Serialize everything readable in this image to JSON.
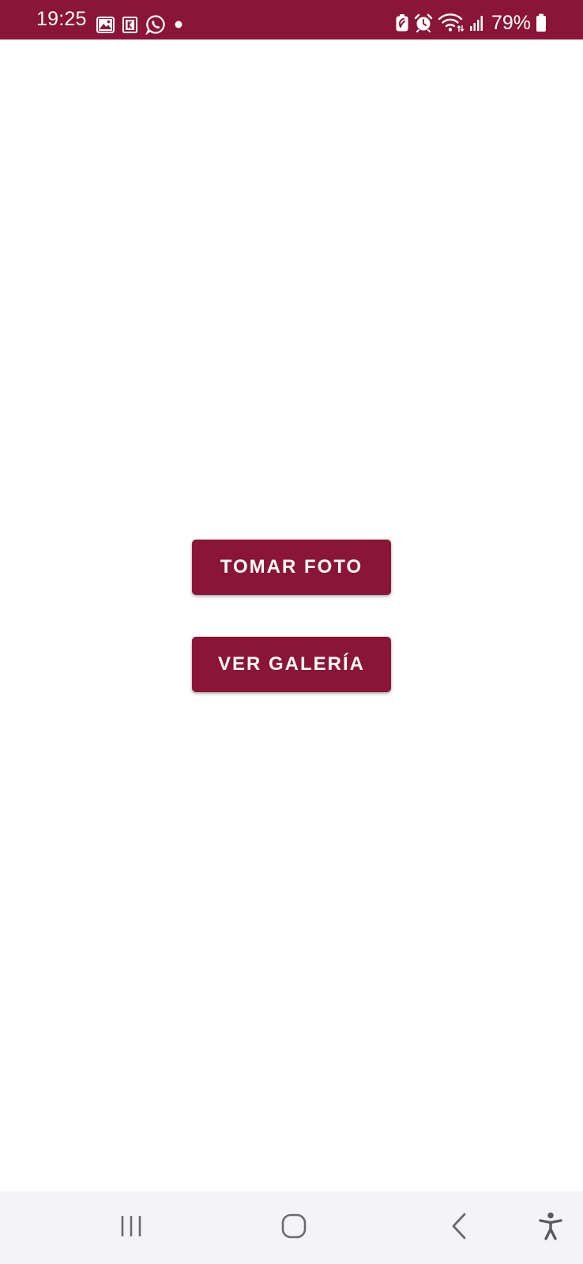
{
  "status_bar": {
    "time": "19:25",
    "battery_percent": "79%",
    "background_color": "#8a1538",
    "left_icons": [
      "gallery-icon",
      "app-notification-icon",
      "whatsapp-icon",
      "dot-icon"
    ],
    "right_icons": [
      "battery-saver-icon",
      "alarm-icon",
      "wifi-icon",
      "signal-icon",
      "battery-icon"
    ]
  },
  "main": {
    "take_photo_label": "TOMAR FOTO",
    "gallery_label": "VER GALERÍA",
    "button_color": "#8a1538"
  },
  "nav_bar": {
    "icons": [
      "recents-icon",
      "home-icon",
      "back-icon",
      "accessibility-icon"
    ]
  }
}
